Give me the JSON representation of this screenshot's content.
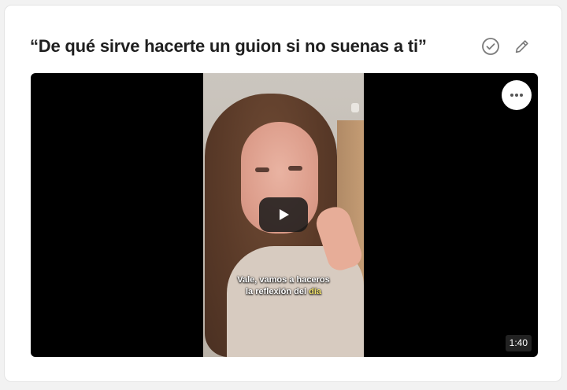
{
  "card": {
    "title": "“De qué sirve hacerte un guion si no suenas a ti”",
    "actions": [
      "check-circle-icon",
      "pencil-icon"
    ]
  },
  "video": {
    "caption_line1": "Vale, vamos a haceros",
    "caption_line2_prefix": "la reflexión del ",
    "caption_line2_highlight": "día",
    "duration": "1:40",
    "play_icon": "play-icon",
    "more_icon": "more-horizontal-icon"
  },
  "colors": {
    "caption_highlight": "#f2e36a",
    "title_text": "#1f1f1f",
    "icon_gray": "#7a7a7a"
  }
}
